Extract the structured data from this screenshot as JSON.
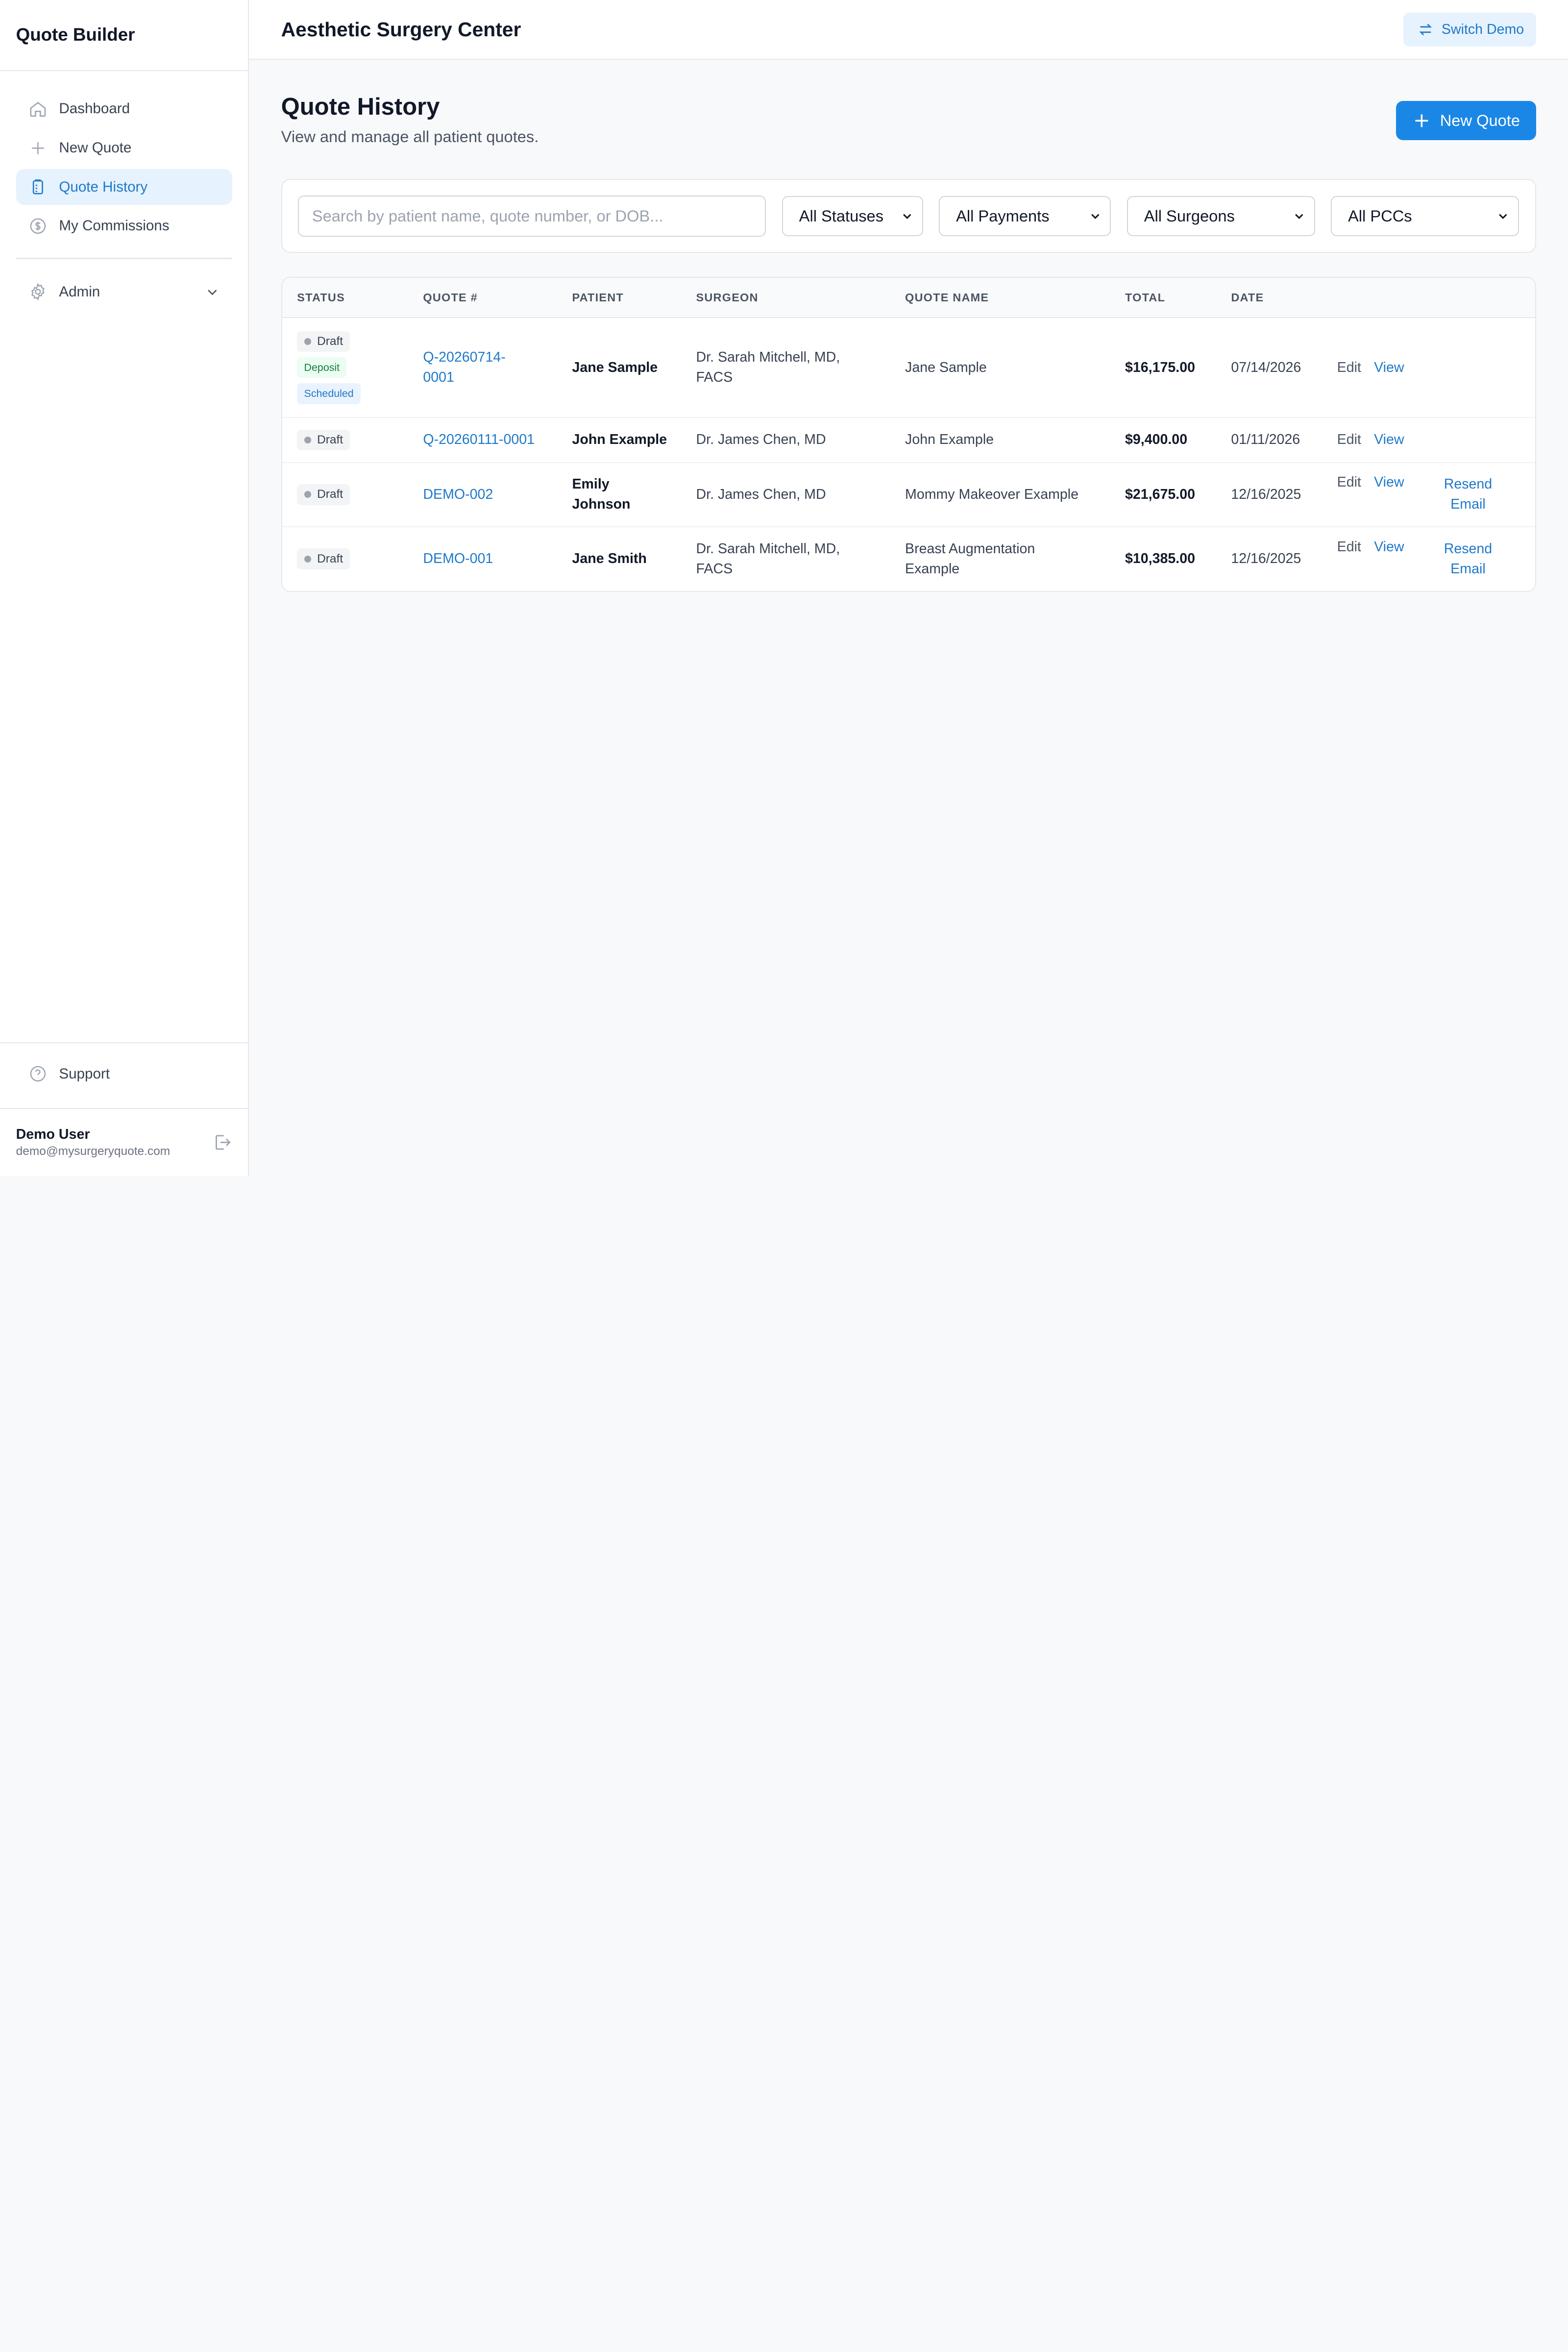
{
  "sidebar": {
    "brand": "Quote Builder",
    "items": [
      {
        "label": "Dashboard",
        "icon": "home-icon"
      },
      {
        "label": "New Quote",
        "icon": "plus-icon"
      },
      {
        "label": "Quote History",
        "icon": "clipboard-icon",
        "active": true
      },
      {
        "label": "My Commissions",
        "icon": "dollar-circle-icon"
      }
    ],
    "admin": {
      "label": "Admin",
      "icon": "gear-icon"
    },
    "support": {
      "label": "Support",
      "icon": "help-circle-icon"
    },
    "user": {
      "name": "Demo User",
      "email": "demo@mysurgeryquote.com"
    }
  },
  "header": {
    "org_name": "Aesthetic Surgery Center",
    "switch_label": "Switch Demo"
  },
  "page": {
    "title": "Quote History",
    "subtitle": "View and manage all patient quotes.",
    "new_quote_label": "New Quote"
  },
  "filters": {
    "search_placeholder": "Search by patient name, quote number, or DOB...",
    "status": "All Statuses",
    "payments": "All Payments",
    "surgeons": "All Surgeons",
    "pccs": "All PCCs"
  },
  "table": {
    "columns": [
      "STATUS",
      "QUOTE #",
      "PATIENT",
      "SURGEON",
      "QUOTE NAME",
      "TOTAL",
      "DATE"
    ],
    "rows": [
      {
        "badges": [
          "Draft",
          "Deposit",
          "Scheduled"
        ],
        "quote_line1": "Q-20260714-",
        "quote_line2": "0001",
        "patient_line1": "Jane Sample",
        "patient_line2": "",
        "surgeon_line1": "Dr. Sarah Mitchell, MD,",
        "surgeon_line2": "FACS",
        "qname_line1": "Jane Sample",
        "qname_line2": "",
        "total": "$16,175.00",
        "date": "07/14/2026",
        "edit": "Edit",
        "view": "View",
        "resend_line1": "",
        "resend_line2": ""
      },
      {
        "badges": [
          "Draft"
        ],
        "quote_line1": "Q-20260111-0001",
        "quote_line2": "",
        "patient_line1": "John Example",
        "patient_line2": "",
        "surgeon_line1": "Dr. James Chen, MD",
        "surgeon_line2": "",
        "qname_line1": "John Example",
        "qname_line2": "",
        "total": "$9,400.00",
        "date": "01/11/2026",
        "edit": "Edit",
        "view": "View",
        "resend_line1": "",
        "resend_line2": ""
      },
      {
        "badges": [
          "Draft"
        ],
        "quote_line1": "DEMO-002",
        "quote_line2": "",
        "patient_line1": "Emily",
        "patient_line2": "Johnson",
        "surgeon_line1": "Dr. James Chen, MD",
        "surgeon_line2": "",
        "qname_line1": "Mommy Makeover Example",
        "qname_line2": "",
        "total": "$21,675.00",
        "date": "12/16/2025",
        "edit": "Edit",
        "view": "View",
        "resend_line1": "Resend",
        "resend_line2": "Email"
      },
      {
        "badges": [
          "Draft"
        ],
        "quote_line1": "DEMO-001",
        "quote_line2": "",
        "patient_line1": "Jane Smith",
        "patient_line2": "",
        "surgeon_line1": "Dr. Sarah Mitchell, MD,",
        "surgeon_line2": "FACS",
        "qname_line1": "Breast Augmentation",
        "qname_line2": "Example",
        "total": "$10,385.00",
        "date": "12/16/2025",
        "edit": "Edit",
        "view": "View",
        "resend_line1": "Resend",
        "resend_line2": "Email"
      }
    ]
  },
  "colors": {
    "accent": "#1a87e6",
    "link": "#1e79c9",
    "active_bg": "#e6f2fd"
  }
}
